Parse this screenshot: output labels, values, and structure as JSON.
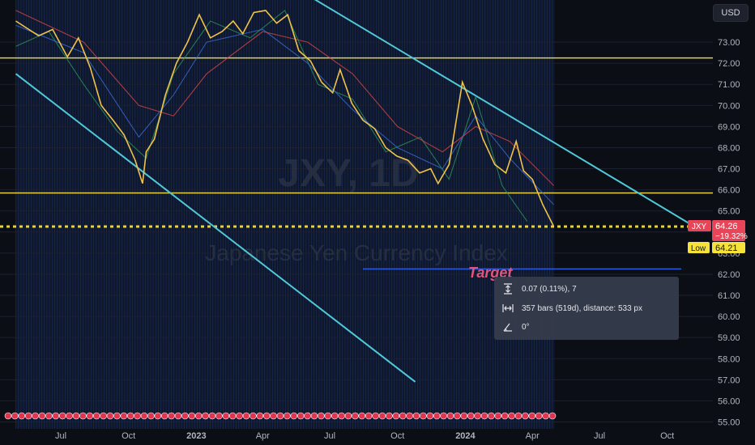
{
  "chart_data": {
    "type": "line",
    "title": "JXY, 1D",
    "subtitle": "Japanese Yen Currency Index",
    "currency": "USD",
    "ylim": [
      55,
      74.6
    ],
    "y_ticks": [
      "55.00",
      "56.00",
      "57.00",
      "58.00",
      "59.00",
      "60.00",
      "61.00",
      "62.00",
      "63.00",
      "64.00",
      "65.00",
      "66.00",
      "67.00",
      "68.00",
      "69.00",
      "70.00",
      "71.00",
      "72.00",
      "73.00"
    ],
    "x_ticks": [
      {
        "label": "Jul",
        "date": "2022-07-01"
      },
      {
        "label": "Oct",
        "date": "2022-10-01"
      },
      {
        "label": "2023",
        "date": "2023-01-01"
      },
      {
        "label": "Apr",
        "date": "2023-04-01"
      },
      {
        "label": "Jul",
        "date": "2023-07-01"
      },
      {
        "label": "Oct",
        "date": "2023-10-01"
      },
      {
        "label": "2024",
        "date": "2024-01-01"
      },
      {
        "label": "Apr",
        "date": "2024-04-01"
      },
      {
        "label": "Jul",
        "date": "2024-07-01"
      },
      {
        "label": "Oct",
        "date": "2024-10-01"
      }
    ],
    "series": [
      {
        "name": "JXY",
        "color": "#f0c24a",
        "points": [
          [
            "2022-05-01",
            74.0
          ],
          [
            "2022-06-01",
            73.3
          ],
          [
            "2022-06-20",
            73.6
          ],
          [
            "2022-07-10",
            72.3
          ],
          [
            "2022-07-25",
            73.2
          ],
          [
            "2022-08-10",
            71.8
          ],
          [
            "2022-08-25",
            70.0
          ],
          [
            "2022-09-10",
            69.3
          ],
          [
            "2022-09-25",
            68.6
          ],
          [
            "2022-10-10",
            67.4
          ],
          [
            "2022-10-20",
            66.3
          ],
          [
            "2022-10-25",
            67.8
          ],
          [
            "2022-11-05",
            68.4
          ],
          [
            "2022-11-20",
            70.5
          ],
          [
            "2022-12-05",
            72.0
          ],
          [
            "2022-12-20",
            73.0
          ],
          [
            "2023-01-05",
            74.3
          ],
          [
            "2023-01-20",
            73.2
          ],
          [
            "2023-02-05",
            73.5
          ],
          [
            "2023-02-20",
            74.0
          ],
          [
            "2023-03-05",
            73.4
          ],
          [
            "2023-03-20",
            74.4
          ],
          [
            "2023-04-05",
            74.5
          ],
          [
            "2023-04-20",
            73.9
          ],
          [
            "2023-05-05",
            74.3
          ],
          [
            "2023-05-20",
            72.6
          ],
          [
            "2023-06-05",
            72.1
          ],
          [
            "2023-06-20",
            71.1
          ],
          [
            "2023-07-05",
            70.6
          ],
          [
            "2023-07-15",
            71.7
          ],
          [
            "2023-07-31",
            70.1
          ],
          [
            "2023-08-15",
            69.3
          ],
          [
            "2023-08-31",
            68.9
          ],
          [
            "2023-09-15",
            68.0
          ],
          [
            "2023-09-30",
            67.6
          ],
          [
            "2023-10-15",
            67.4
          ],
          [
            "2023-10-31",
            66.8
          ],
          [
            "2023-11-15",
            67.0
          ],
          [
            "2023-11-25",
            66.3
          ],
          [
            "2023-12-10",
            67.2
          ],
          [
            "2023-12-28",
            71.1
          ],
          [
            "2024-01-10",
            70.0
          ],
          [
            "2024-01-25",
            68.4
          ],
          [
            "2024-02-10",
            67.2
          ],
          [
            "2024-02-25",
            66.8
          ],
          [
            "2024-03-10",
            68.3
          ],
          [
            "2024-03-20",
            66.9
          ],
          [
            "2024-04-01",
            66.5
          ],
          [
            "2024-04-15",
            65.3
          ],
          [
            "2024-04-30",
            64.26
          ]
        ]
      },
      {
        "name": "",
        "color": "#e04848",
        "points": [
          [
            "2022-05-01",
            74.5
          ],
          [
            "2022-08-01",
            73.0
          ],
          [
            "2022-10-15",
            70.0
          ],
          [
            "2022-12-01",
            69.5
          ],
          [
            "2023-01-15",
            71.5
          ],
          [
            "2023-04-01",
            73.5
          ],
          [
            "2023-06-01",
            73.0
          ],
          [
            "2023-08-01",
            71.5
          ],
          [
            "2023-10-01",
            69.0
          ],
          [
            "2023-12-01",
            67.8
          ],
          [
            "2024-01-15",
            69.0
          ],
          [
            "2024-03-01",
            68.3
          ],
          [
            "2024-04-30",
            66.2
          ]
        ]
      },
      {
        "name": "",
        "color": "#3b6fd8",
        "points": [
          [
            "2022-05-01",
            73.8
          ],
          [
            "2022-08-01",
            72.5
          ],
          [
            "2022-10-15",
            68.5
          ],
          [
            "2022-12-01",
            70.5
          ],
          [
            "2023-01-15",
            73.0
          ],
          [
            "2023-04-01",
            73.6
          ],
          [
            "2023-06-01",
            72.0
          ],
          [
            "2023-08-01",
            69.8
          ],
          [
            "2023-10-01",
            68.0
          ],
          [
            "2023-12-01",
            67.0
          ],
          [
            "2024-01-15",
            69.5
          ],
          [
            "2024-03-01",
            67.5
          ],
          [
            "2024-04-30",
            65.3
          ]
        ]
      },
      {
        "name": "",
        "color": "#2e9a5a",
        "points": [
          [
            "2022-05-01",
            72.8
          ],
          [
            "2022-06-15",
            73.5
          ],
          [
            "2022-08-01",
            71.0
          ],
          [
            "2022-09-15",
            68.8
          ],
          [
            "2022-10-25",
            67.5
          ],
          [
            "2022-12-01",
            71.5
          ],
          [
            "2023-01-20",
            74.0
          ],
          [
            "2023-03-15",
            73.2
          ],
          [
            "2023-05-01",
            74.5
          ],
          [
            "2023-06-15",
            71.0
          ],
          [
            "2023-08-01",
            70.3
          ],
          [
            "2023-09-15",
            67.8
          ],
          [
            "2023-11-01",
            68.5
          ],
          [
            "2023-12-10",
            66.5
          ],
          [
            "2024-01-15",
            70.4
          ],
          [
            "2024-02-20",
            66.2
          ],
          [
            "2024-03-25",
            64.5
          ]
        ]
      }
    ],
    "horizontal_lines": [
      {
        "y": 72.25,
        "color": "#e8d13a",
        "style": "solid"
      },
      {
        "y": 65.85,
        "color": "#e8d13a",
        "style": "solid"
      },
      {
        "y": 64.26,
        "color": "#e8d13a",
        "style": "dashed"
      }
    ],
    "target_line": {
      "y": 62.25,
      "from": "2023-08-15",
      "to": "2024-10-20",
      "color": "#2e56d8"
    },
    "trend_lines": [
      {
        "from": [
          "2022-05-01",
          71.5
        ],
        "to": [
          "2023-10-25",
          56.9
        ]
      },
      {
        "from": [
          "2023-04-25",
          76.0
        ],
        "to": [
          "2024-11-05",
          64.3
        ]
      }
    ],
    "shaded_area": {
      "from": "2022-05-01",
      "to": "2024-05-01",
      "color": "#2a4fb5"
    },
    "annotations": {
      "target": "Target"
    },
    "price_label": {
      "ticker": "JXY",
      "value": "64.26",
      "change": "−19.32%"
    },
    "low_label": {
      "text": "Low",
      "value": "64.21"
    },
    "measure": {
      "price": "0.07 (0.11%), 7",
      "bars": "357 bars (519d), distance: 533 px",
      "angle": "0°"
    }
  }
}
